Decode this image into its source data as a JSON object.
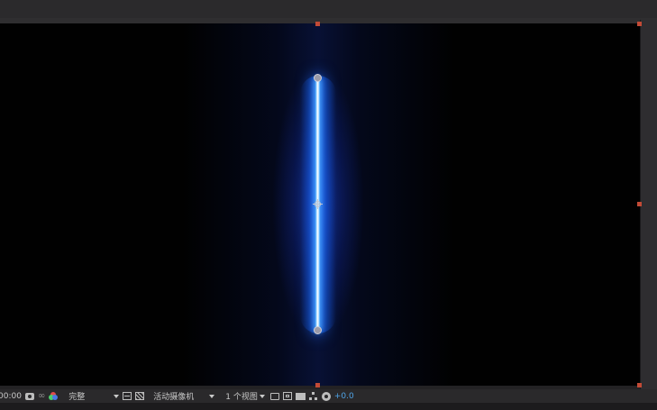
{
  "toolbar": {
    "timecode": "00:00",
    "resolution": "完整",
    "camera": "活动摄像机",
    "views": "1 个视图",
    "exposure": "+0.0"
  },
  "colors": {
    "beam_core": "#ffffff",
    "beam_glow": "#1e6eff",
    "handle": "#c24a36",
    "exposure": "#4fa3e6"
  },
  "icons": [
    "camera-icon",
    "link-icon",
    "color-channels-icon",
    "grid-icon",
    "transparency-grid-icon",
    "region-icon",
    "frame-icon",
    "image-icon",
    "flowchart-icon",
    "exposure-reset-icon"
  ]
}
